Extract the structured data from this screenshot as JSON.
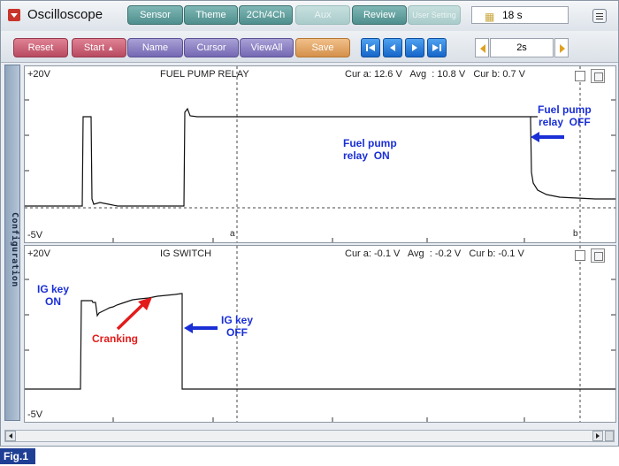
{
  "app": {
    "title": "Oscilloscope"
  },
  "tabs": [
    {
      "label": "Sensor"
    },
    {
      "label": "Theme"
    },
    {
      "label": "2Ch/4Ch"
    },
    {
      "label": "Aux"
    },
    {
      "label": "Review"
    },
    {
      "label": "User Setting"
    }
  ],
  "timer": {
    "value": "18 s"
  },
  "toolbar": {
    "reset": "Reset",
    "start": "Start",
    "name": "Name",
    "cursor": "Cursor",
    "viewall": "ViewAll",
    "save": "Save"
  },
  "timebase": {
    "value": "2s"
  },
  "side_panel": {
    "label": "Configuration"
  },
  "channels": [
    {
      "title": "FUEL PUMP RELAY",
      "top_scale": "+20V",
      "bottom_scale": "-5V",
      "cursor_readout": "Cur a: 12.6 V   Avg  : 10.8 V   Cur b: 0.7 V",
      "cursor_a": "a",
      "cursor_b": "b",
      "annotations": [
        {
          "text": "Fuel pump\nrelay  ON",
          "color": "#1a2fd6"
        },
        {
          "text": "Fuel pump\nrelay  OFF",
          "color": "#1a2fd6"
        }
      ]
    },
    {
      "title": "IG SWITCH",
      "top_scale": "+20V",
      "bottom_scale": "-5V",
      "cursor_readout": "Cur a: -0.1 V   Avg  : -0.2 V   Cur b: -0.1 V",
      "annotations": [
        {
          "text": "IG key\nON",
          "color": "#1a2fd6"
        },
        {
          "text": "Cranking",
          "color": "#e31b1b"
        },
        {
          "text": "IG key\nOFF",
          "color": "#1a2fd6"
        }
      ]
    }
  ],
  "figure_caption": "Fig.1",
  "colors": {
    "annotation_blue": "#1a2fd6",
    "annotation_red": "#e31b1b",
    "tab_teal": "#5f9e9c",
    "nav_blue": "#1f77e0"
  }
}
